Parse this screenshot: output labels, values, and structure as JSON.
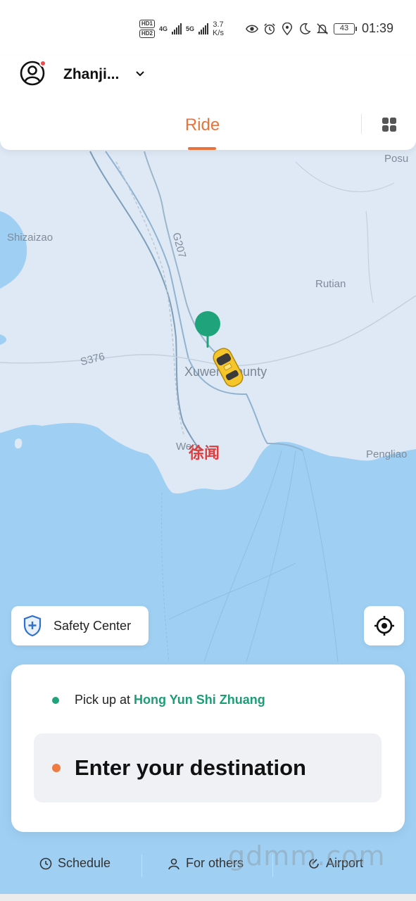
{
  "status_bar": {
    "hd1": "HD1",
    "hd2": "HD2",
    "net1": "4G",
    "net2": "5G",
    "speed_value": "3.7",
    "speed_unit": "K/s",
    "battery": "43",
    "time": "01:39"
  },
  "header": {
    "city": "Zhanji...",
    "tab_ride": "Ride"
  },
  "map": {
    "labels": {
      "posu": "Posu",
      "shizaizao": "Shizaizao",
      "g207": "G207",
      "rutian": "Rutian",
      "s376": "S376",
      "xuwen_county": "Xuwen County",
      "xuwen_cn": "徐闻",
      "xuwen_en": "Wen",
      "pengliao": "Pengliao"
    }
  },
  "safety": {
    "label": "Safety Center"
  },
  "booking": {
    "pickup_prefix": "Pick up at",
    "pickup_place": "Hong Yun Shi Zhuang",
    "destination_placeholder": "Enter your destination"
  },
  "actions": {
    "schedule": "Schedule",
    "for_others": "For others",
    "airport": "Airport"
  },
  "watermark": "gdmm.com",
  "colors": {
    "accent": "#e8733d",
    "pickup_green": "#1b9e74",
    "land": "#dfe9f6",
    "water": "#9fd0f4"
  }
}
